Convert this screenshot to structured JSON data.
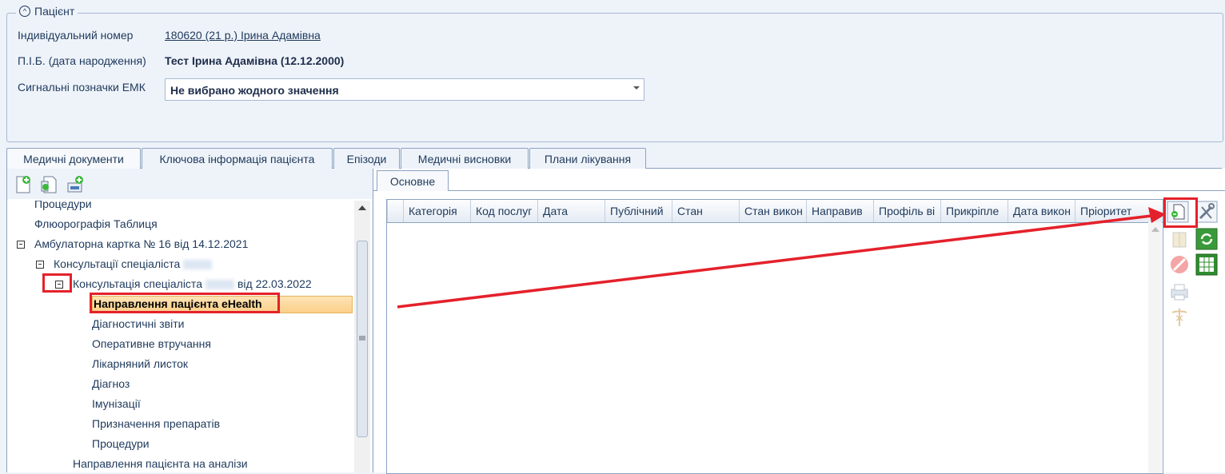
{
  "patient": {
    "group_title": "Пацієнт",
    "id_label": "Індивідуальний номер",
    "id_value": "180620 (21 р.) Ірина Адамівна",
    "name_label": "П.І.Б. (дата народження)",
    "name_value": "Тест Ірина Адамівна (12.12.2000)",
    "signal_label": "Сигнальні позначки ЕМК",
    "signal_value": "Не вибрано жодного значення"
  },
  "tabs": [
    "Медичні документи",
    "Ключова інформація пацієнта",
    "Епізоди",
    "Медичні висновки",
    "Плани лікування"
  ],
  "tree": {
    "items": [
      "Процедури",
      "Флюорографія Таблиця",
      "Амбулаторна картка № 16 від 14.12.2021",
      "Консультації спеціаліста",
      "Консультація спеціаліста",
      "від 22.03.2022",
      "Направлення пацієнта eHealth",
      "Діагностичні звіти",
      "Оперативне втручання",
      "Лікарняний листок",
      "Діагноз",
      "Імунізації",
      "Призначення препаратів",
      "Процедури",
      "Направлення пацієнта на аналізи"
    ]
  },
  "subtab": "Основне",
  "grid": {
    "columns": [
      "Категорія",
      "Код послуг",
      "Дата",
      "Публічний",
      "Стан",
      "Стан викон",
      "Направив",
      "Профіль ві",
      "Прикріпле",
      "Дата викон",
      "Пріоритет"
    ]
  },
  "colors": {
    "highlight_border": "#e4212b",
    "selected_bg": "#fbd89a",
    "accent": "#1e395b"
  }
}
